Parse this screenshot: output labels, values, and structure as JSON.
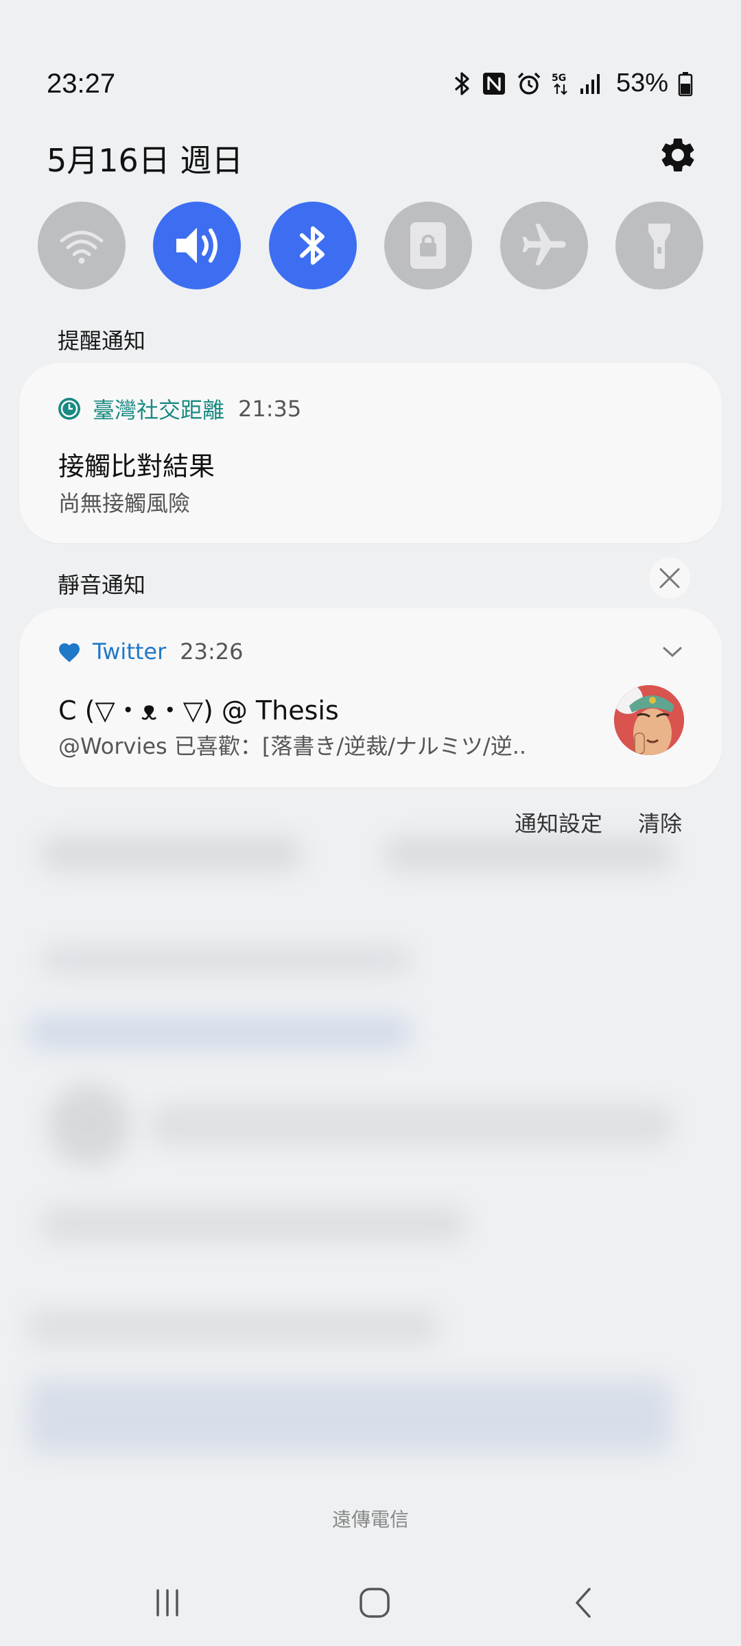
{
  "status_bar": {
    "time": "23:27",
    "battery": "53%",
    "icons": [
      "bluetooth-icon",
      "nfc-icon",
      "alarm-icon",
      "5g-icon",
      "signal-icon",
      "battery-icon"
    ]
  },
  "header": {
    "date": "5月16日 週日",
    "settings_icon": "gear-icon"
  },
  "quick_tiles": [
    {
      "name": "wifi",
      "icon": "wifi-icon",
      "on": false
    },
    {
      "name": "sound",
      "icon": "volume-icon",
      "on": true
    },
    {
      "name": "bluetooth",
      "icon": "bluetooth-icon",
      "on": true
    },
    {
      "name": "rotation-lock",
      "icon": "lock-icon",
      "on": false
    },
    {
      "name": "airplane",
      "icon": "airplane-icon",
      "on": false
    },
    {
      "name": "flashlight",
      "icon": "flashlight-icon",
      "on": false
    }
  ],
  "sections": {
    "alerting_label": "提醒通知",
    "silent_label": "靜音通知"
  },
  "notifications": {
    "alerting": {
      "app": "臺灣社交距離",
      "time": "21:35",
      "title": "接觸比對結果",
      "body": "尚無接觸風險"
    },
    "silent": {
      "app": "Twitter",
      "time": "23:26",
      "title": "C (▽・ᴥ・▽) @ Thesis",
      "body": "@Worvies 已喜歡：[落書き/逆裁/ナルミツ/逆.."
    }
  },
  "actions": {
    "settings": "通知設定",
    "clear": "清除"
  },
  "carrier": "遠傳電信",
  "colors": {
    "accent": "#3d6ef2",
    "tile_off": "#bdbec1",
    "teal": "#1a8a82",
    "twitter_blue": "#1f78c8"
  }
}
